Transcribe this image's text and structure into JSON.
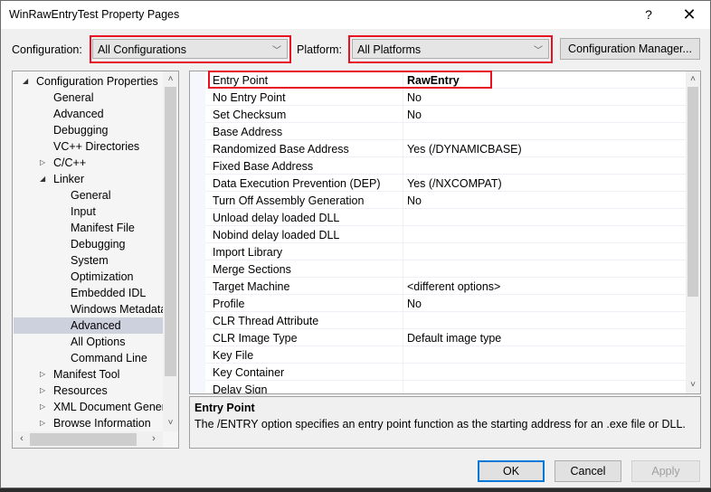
{
  "window": {
    "title": "WinRawEntryTest Property Pages",
    "help_label": "?",
    "close_label": "✕"
  },
  "toolbar": {
    "configuration_label": "Configuration:",
    "configuration_value": "All Configurations",
    "platform_label": "Platform:",
    "platform_value": "All Platforms",
    "config_manager_label": "Configuration Manager...",
    "dropdown_arrow": "﹀"
  },
  "tree": {
    "items": [
      {
        "label": "Configuration Properties",
        "level": 0,
        "expander": "expanded"
      },
      {
        "label": "General",
        "level": 1,
        "expander": "none"
      },
      {
        "label": "Advanced",
        "level": 1,
        "expander": "none"
      },
      {
        "label": "Debugging",
        "level": 1,
        "expander": "none"
      },
      {
        "label": "VC++ Directories",
        "level": 1,
        "expander": "none"
      },
      {
        "label": "C/C++",
        "level": 1,
        "expander": "collapsed"
      },
      {
        "label": "Linker",
        "level": 1,
        "expander": "expanded"
      },
      {
        "label": "General",
        "level": 2,
        "expander": "none"
      },
      {
        "label": "Input",
        "level": 2,
        "expander": "none"
      },
      {
        "label": "Manifest File",
        "level": 2,
        "expander": "none"
      },
      {
        "label": "Debugging",
        "level": 2,
        "expander": "none"
      },
      {
        "label": "System",
        "level": 2,
        "expander": "none"
      },
      {
        "label": "Optimization",
        "level": 2,
        "expander": "none"
      },
      {
        "label": "Embedded IDL",
        "level": 2,
        "expander": "none"
      },
      {
        "label": "Windows Metadata",
        "level": 2,
        "expander": "none"
      },
      {
        "label": "Advanced",
        "level": 2,
        "expander": "none",
        "selected": true
      },
      {
        "label": "All Options",
        "level": 2,
        "expander": "none"
      },
      {
        "label": "Command Line",
        "level": 2,
        "expander": "none"
      },
      {
        "label": "Manifest Tool",
        "level": 1,
        "expander": "collapsed"
      },
      {
        "label": "Resources",
        "level": 1,
        "expander": "collapsed"
      },
      {
        "label": "XML Document Genera",
        "level": 1,
        "expander": "collapsed"
      },
      {
        "label": "Browse Information",
        "level": 1,
        "expander": "collapsed"
      }
    ]
  },
  "properties": {
    "rows": [
      {
        "name": "Entry Point",
        "value": "RawEntry",
        "bold": true
      },
      {
        "name": "No Entry Point",
        "value": "No"
      },
      {
        "name": "Set Checksum",
        "value": "No"
      },
      {
        "name": "Base Address",
        "value": ""
      },
      {
        "name": "Randomized Base Address",
        "value": "Yes (/DYNAMICBASE)"
      },
      {
        "name": "Fixed Base Address",
        "value": ""
      },
      {
        "name": "Data Execution Prevention (DEP)",
        "value": "Yes (/NXCOMPAT)"
      },
      {
        "name": "Turn Off Assembly Generation",
        "value": "No"
      },
      {
        "name": "Unload delay loaded DLL",
        "value": ""
      },
      {
        "name": "Nobind delay loaded DLL",
        "value": ""
      },
      {
        "name": "Import Library",
        "value": ""
      },
      {
        "name": "Merge Sections",
        "value": ""
      },
      {
        "name": "Target Machine",
        "value": "<different options>"
      },
      {
        "name": "Profile",
        "value": "No"
      },
      {
        "name": "CLR Thread Attribute",
        "value": ""
      },
      {
        "name": "CLR Image Type",
        "value": "Default image type"
      },
      {
        "name": "Key File",
        "value": ""
      },
      {
        "name": "Key Container",
        "value": ""
      },
      {
        "name": "Delay Sign",
        "value": ""
      }
    ]
  },
  "description": {
    "title": "Entry Point",
    "text": "The /ENTRY option specifies an entry point function as the starting address for an .exe file or DLL."
  },
  "buttons": {
    "ok": "OK",
    "cancel": "Cancel",
    "apply": "Apply"
  },
  "scroll_glyphs": {
    "up": "˄",
    "down": "˅",
    "left": "‹",
    "right": "›"
  },
  "accent_colors": {
    "highlight_box": "#e81123",
    "selection": "#cdd0dd",
    "focus": "#0078d7"
  }
}
